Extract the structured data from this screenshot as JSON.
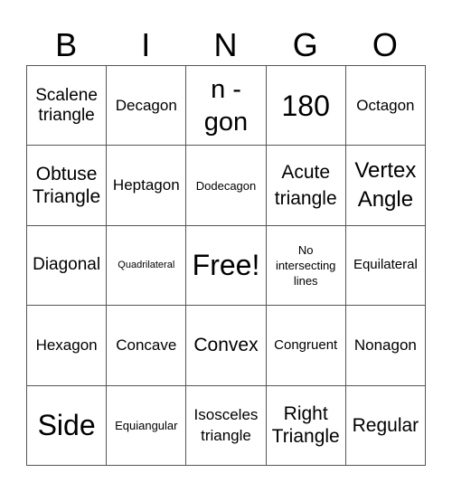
{
  "header": {
    "letters": [
      "B",
      "I",
      "N",
      "G",
      "O"
    ]
  },
  "cells": [
    [
      "Scalene triangle",
      "Decagon",
      "n - gon",
      "180",
      "Octagon"
    ],
    [
      "Obtuse Triangle",
      "Heptagon",
      "Dodecagon",
      "Acute triangle",
      "Vertex Angle"
    ],
    [
      "Diagonal",
      "Quadrilateral",
      "Free!",
      "No intersecting lines",
      "Equilateral"
    ],
    [
      "Hexagon",
      "Concave",
      "Convex",
      "Congruent",
      "Nonagon"
    ],
    [
      "Side",
      "Equiangular",
      "Isosceles triangle",
      "Right Triangle",
      "Regular"
    ]
  ],
  "colors": {
    "grid_line": "#555555",
    "text": "#000000",
    "background": "#ffffff"
  }
}
